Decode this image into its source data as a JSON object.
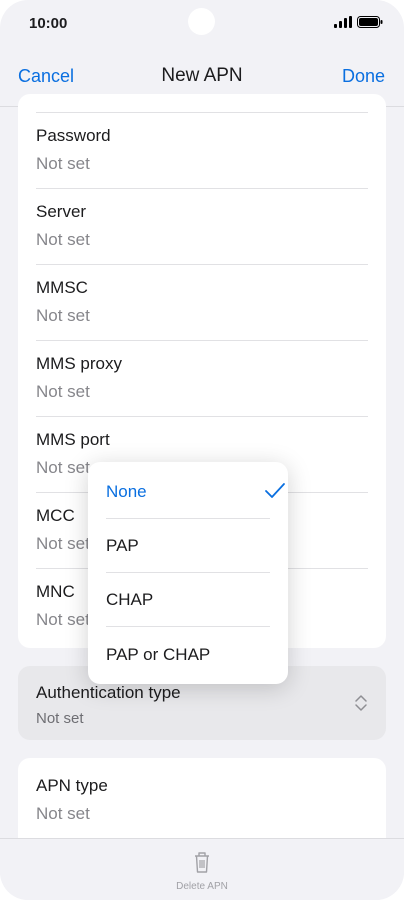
{
  "status_bar": {
    "time": "10:00",
    "signal_icon": "signal-bars-icon",
    "battery_icon": "battery-icon"
  },
  "nav": {
    "cancel_label": "Cancel",
    "title": "New APN",
    "done_label": "Done"
  },
  "fields": [
    {
      "label": "Password",
      "value": "Not set"
    },
    {
      "label": "Server",
      "value": "Not set"
    },
    {
      "label": "MMSC",
      "value": "Not set"
    },
    {
      "label": "MMS proxy",
      "value": "Not set"
    },
    {
      "label": "MMS port",
      "value": "Not set"
    },
    {
      "label": "MCC",
      "value": "Not set"
    },
    {
      "label": "MNC",
      "value": "Not set"
    }
  ],
  "authentication": {
    "label": "Authentication type",
    "value": "Not set",
    "icon": "chevron-up-down-icon"
  },
  "auth_menu": {
    "options": [
      {
        "label": "None",
        "selected": true
      },
      {
        "label": "PAP",
        "selected": false
      },
      {
        "label": "CHAP",
        "selected": false
      },
      {
        "label": "PAP or CHAP",
        "selected": false
      }
    ],
    "check_icon": "checkmark-icon"
  },
  "apn_type": {
    "label": "APN type",
    "value": "Not set"
  },
  "bottom_bar": {
    "delete_label": "Delete APN",
    "icon": "trash-icon"
  },
  "colors": {
    "accent": "#0a6fe0",
    "background": "#f2f2f6",
    "secondary_text": "#86868b"
  }
}
